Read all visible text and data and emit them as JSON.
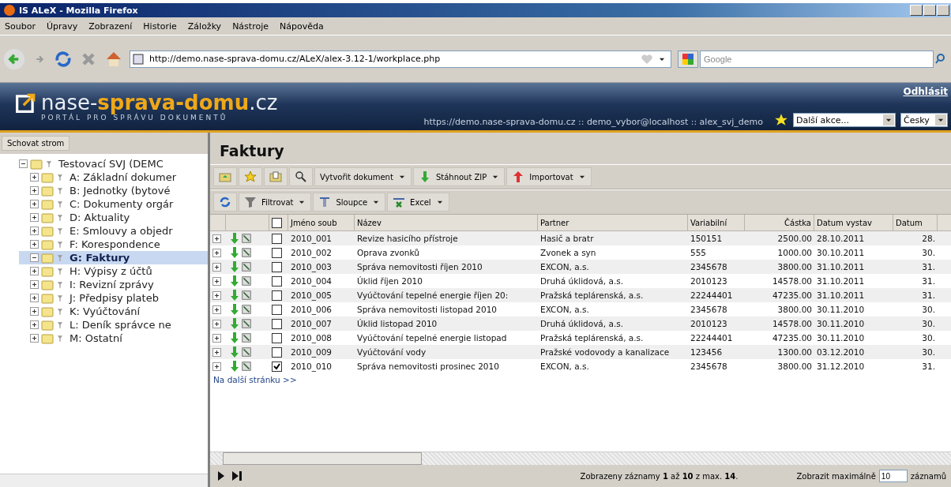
{
  "window": {
    "title": "IS ALeX - Mozilla Firefox"
  },
  "menu": [
    "Soubor",
    "Úpravy",
    "Zobrazení",
    "Historie",
    "Záložky",
    "Nástroje",
    "Nápověda"
  ],
  "address": {
    "value": "http://demo.nase-sprava-domu.cz/ALeX/alex-3.12-1/workplace.php"
  },
  "search": {
    "placeholder": "Google"
  },
  "banner": {
    "logo_plain": "nase-",
    "logo_accent": "sprava-domu",
    "logo_tld": ".cz",
    "tagline": "PORTÁL PRO SPRÁVU DOKUMENTŮ",
    "logout": "Odhlásit",
    "info": "https://demo.nase-sprava-domu.cz :: demo_vybor@localhost :: alex_svj_demo",
    "actions": "Další akce...",
    "language": "Česky"
  },
  "sidebar": {
    "hide_button": "Schovat strom",
    "tree": [
      {
        "label": "Testovací SVJ (DEMC",
        "expanded": true,
        "selected": false,
        "children": [
          {
            "label": "A: Základní dokumer",
            "expanded": false,
            "selected": false
          },
          {
            "label": "B: Jednotky (bytové",
            "expanded": false,
            "selected": false
          },
          {
            "label": "C: Dokumenty orgár",
            "expanded": false,
            "selected": false
          },
          {
            "label": "D: Aktuality",
            "expanded": false,
            "selected": false
          },
          {
            "label": "E: Smlouvy a objedr",
            "expanded": false,
            "selected": false
          },
          {
            "label": "F: Korespondence",
            "expanded": false,
            "selected": false
          },
          {
            "label": "G: Faktury",
            "expanded": true,
            "selected": true
          },
          {
            "label": "H: Výpisy z účtů",
            "expanded": false,
            "selected": false
          },
          {
            "label": "I: Revizní zprávy",
            "expanded": false,
            "selected": false
          },
          {
            "label": "J: Předpisy plateb",
            "expanded": false,
            "selected": false
          },
          {
            "label": "K: Vyúčtování",
            "expanded": false,
            "selected": false
          },
          {
            "label": "L: Deník správce ne",
            "expanded": false,
            "selected": false
          },
          {
            "label": "M: Ostatní",
            "expanded": false,
            "selected": false
          }
        ]
      }
    ]
  },
  "main": {
    "title": "Faktury",
    "toolbar_1": [
      {
        "kind": "icon"
      },
      {
        "kind": "icon"
      },
      {
        "kind": "icon"
      },
      {
        "kind": "icon"
      },
      {
        "kind": "menu",
        "label": "Vytvořit dokument"
      },
      {
        "kind": "menu",
        "label": "Stáhnout ZIP"
      },
      {
        "kind": "menu",
        "label": "Importovat"
      }
    ],
    "toolbar_2": [
      {
        "kind": "icon"
      },
      {
        "kind": "menu",
        "label": "Filtrovat"
      },
      {
        "kind": "menu",
        "label": "Sloupce"
      },
      {
        "kind": "menu",
        "label": "Excel"
      }
    ],
    "table": {
      "select_all_checked": false,
      "columns": [
        "Jméno soub",
        "Název",
        "Partner",
        "Variabilní",
        "Částka",
        "Datum vystav",
        "Datum"
      ],
      "rows": [
        {
          "checked": false,
          "cells": [
            "2010_001",
            "Revize hasicího přístroje",
            "Hasič a bratr",
            "150151",
            "2500.00",
            "28.10.2011",
            "28."
          ]
        },
        {
          "checked": false,
          "cells": [
            "2010_002",
            "Oprava zvonků",
            "Zvonek a syn",
            "555",
            "1000.00",
            "30.10.2011",
            "30."
          ]
        },
        {
          "checked": false,
          "cells": [
            "2010_003",
            "Správa nemovitosti říjen 2010",
            "EXCON, a.s.",
            "2345678",
            "3800.00",
            "31.10.2011",
            "31."
          ]
        },
        {
          "checked": false,
          "cells": [
            "2010_004",
            "Úklid říjen 2010",
            "Druhá úklidová, a.s.",
            "2010123",
            "14578.00",
            "31.10.2011",
            "31."
          ]
        },
        {
          "checked": false,
          "cells": [
            "2010_005",
            "Vyúčtování tepelné energie říjen 20:",
            "Pražská teplárenská, a.s.",
            "22244401",
            "47235.00",
            "31.10.2011",
            "31."
          ]
        },
        {
          "checked": false,
          "cells": [
            "2010_006",
            "Správa nemovitosti listopad 2010",
            "EXCON, a.s.",
            "2345678",
            "3800.00",
            "30.11.2010",
            "30."
          ]
        },
        {
          "checked": false,
          "cells": [
            "2010_007",
            "Úklid listopad 2010",
            "Druhá úklidová, a.s.",
            "2010123",
            "14578.00",
            "30.11.2010",
            "30."
          ]
        },
        {
          "checked": false,
          "cells": [
            "2010_008",
            "Vyúčtování tepelné energie listopad",
            "Pražská teplárenská, a.s.",
            "22244401",
            "47235.00",
            "30.11.2010",
            "30."
          ]
        },
        {
          "checked": false,
          "cells": [
            "2010_009",
            "Vyúčtování vody",
            "Pražské vodovody a kanalizace",
            "123456",
            "1300.00",
            "03.12.2010",
            "30."
          ]
        },
        {
          "checked": true,
          "cells": [
            "2010_010",
            "Správa nemovitosti prosinec 2010",
            "EXCON, a.s.",
            "2345678",
            "3800.00",
            "31.12.2010",
            "31."
          ]
        }
      ]
    },
    "next_page": "Na další stránku >>",
    "footer": {
      "records": "Zobrazeny záznamy **1** až **10** z max. **14**.",
      "max_label": "Zobrazit maximálně",
      "max_value": "10",
      "max_unit": "záznamů"
    }
  }
}
